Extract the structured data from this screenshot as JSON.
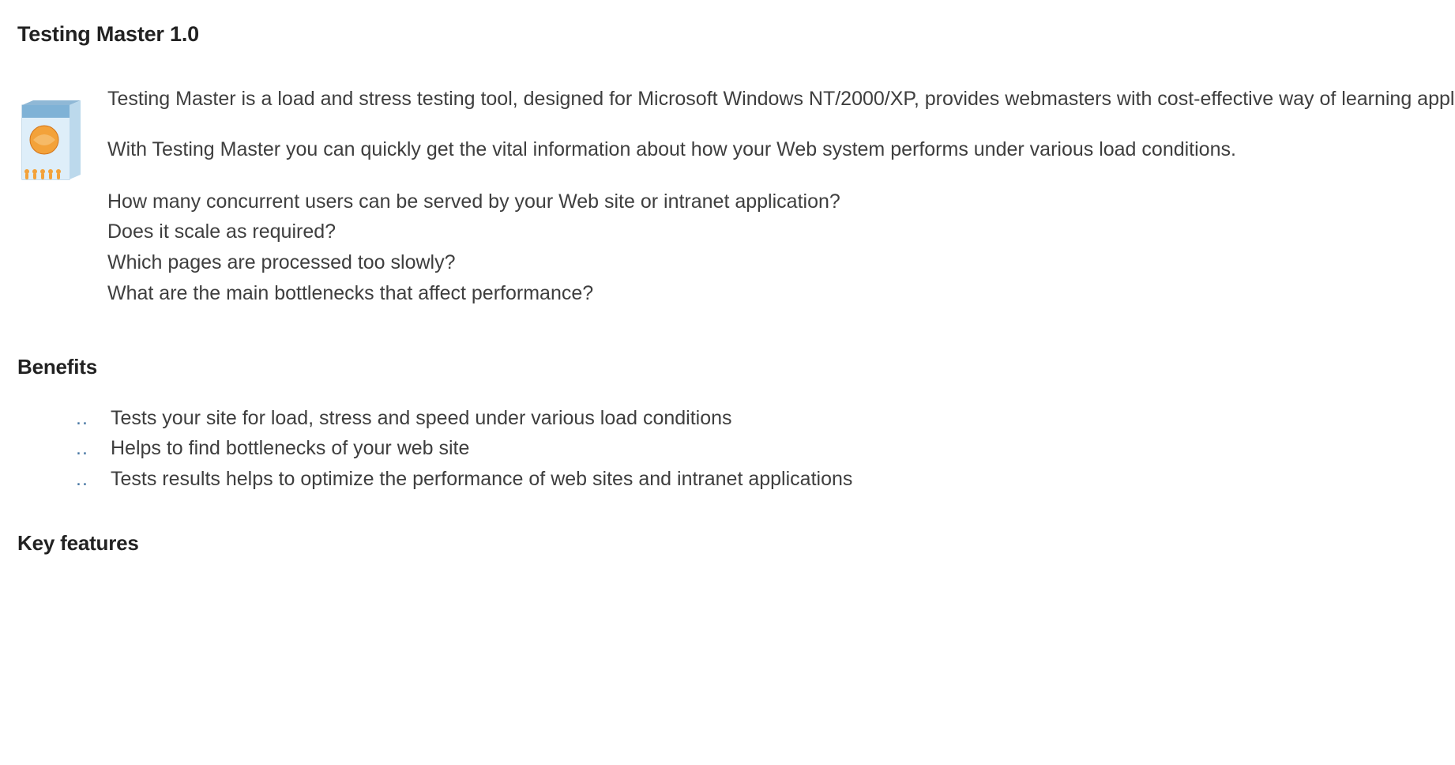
{
  "title": "Testing Master 1.0",
  "intro": {
    "p1": "Testing Master is a load and stress testing tool, designed for Microsoft Windows NT/2000/XP, provides webmasters with cost-effective way of learning application performance characteristics and finding bottlenecks. Testing Master have many features, using for test sites with complex dynamic content. You can analyze test results, presented in descriptive graphs and text reports.",
    "p2": "With Testing Master you can quickly get the vital information about how your Web system performs under various load conditions.",
    "questions": [
      "How many concurrent users can be served by your Web site or intranet application?",
      "Does it scale as required?",
      "Which pages are processed too slowly?",
      "What are the main bottlenecks that affect performance?"
    ]
  },
  "sections": {
    "benefits_heading": "Benefits",
    "benefits_items": [
      "Tests your site for load, stress and speed under various load conditions",
      "Helps to find bottlenecks of your web site",
      "Tests results helps to optimize the performance of web sites and intranet applications"
    ],
    "key_features_heading": "Key features"
  },
  "art": {
    "name": "product-boxshot"
  }
}
